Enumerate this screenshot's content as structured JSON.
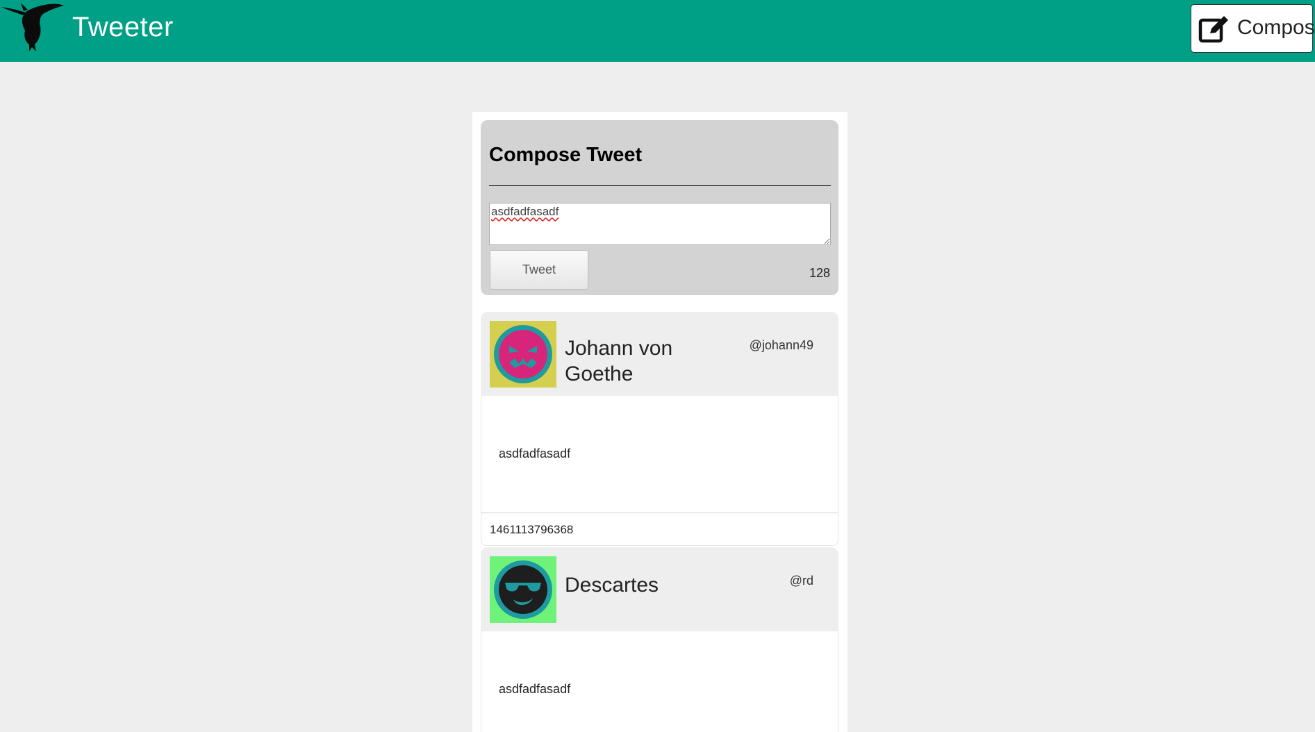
{
  "app": {
    "title": "Tweeter",
    "logo_icon": "hummingbird-icon",
    "brand_color": "#00a087"
  },
  "nav": {
    "compose_label": "Compose",
    "compose_icon": "edit-icon"
  },
  "compose": {
    "heading": "Compose Tweet",
    "textarea_value": "asdfadfasadf",
    "tweet_button_label": "Tweet",
    "char_count": "128"
  },
  "tweets": [
    {
      "name": "Johann von Goethe",
      "handle": "@johann49",
      "text": "asdfadfasadf",
      "timestamp": "1461113796368",
      "avatar_icon": "angry-face-icon",
      "avatar_bg": "#d4cf4f",
      "avatar_face": "#d6257a"
    },
    {
      "name": "Descartes",
      "handle": "@rd",
      "text": "asdfadfasadf",
      "avatar_icon": "sunglasses-face-icon",
      "avatar_bg": "#6ff27a",
      "avatar_face": "#1e1e1e"
    }
  ]
}
